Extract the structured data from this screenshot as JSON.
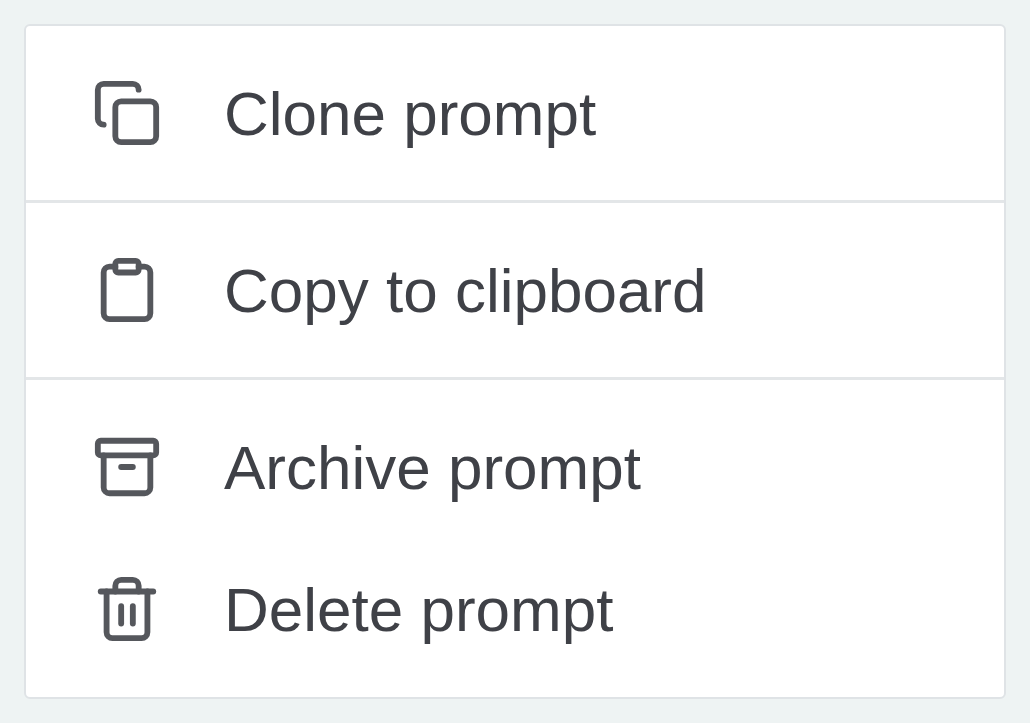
{
  "menu": {
    "sections": [
      {
        "items": [
          {
            "label": "Clone prompt"
          }
        ]
      },
      {
        "items": [
          {
            "label": "Copy to clipboard"
          }
        ]
      },
      {
        "items": [
          {
            "label": "Archive prompt"
          },
          {
            "label": "Delete prompt"
          }
        ]
      }
    ]
  }
}
